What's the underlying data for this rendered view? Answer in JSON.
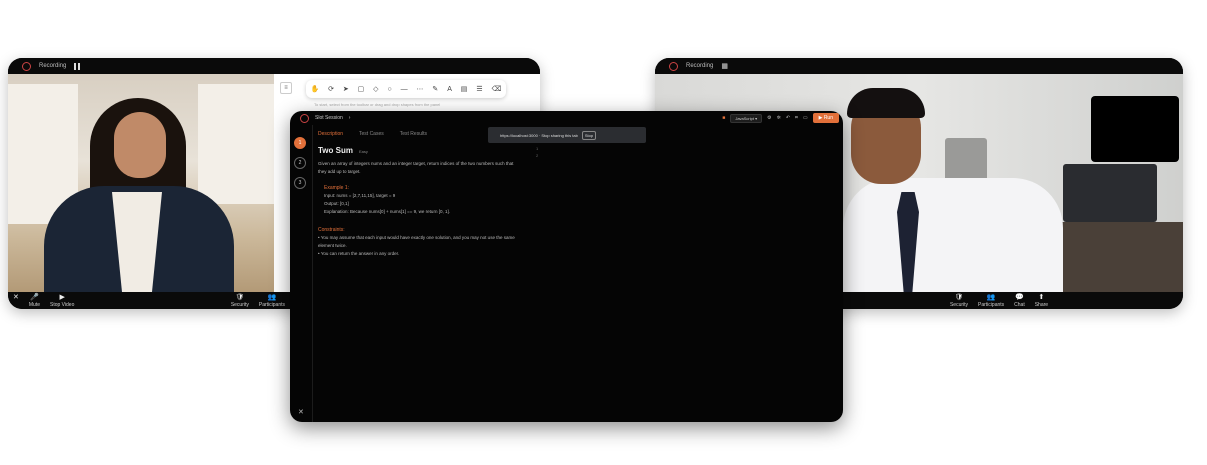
{
  "left_window": {
    "topbar_label": "Recording",
    "whiteboard_hint": "To start, select from the toolbar or drag and drop shapes from the panel",
    "whiteboard_tools": [
      "✋",
      "⟳",
      "➤",
      "▢",
      "◇",
      "○",
      "—",
      "⋯",
      "✎",
      "A",
      "▤",
      "☰",
      "⌫"
    ],
    "bottom_left": [
      {
        "icon": "✕",
        "label": ""
      },
      {
        "icon": "🎤",
        "label": "Mute"
      },
      {
        "icon": "▶",
        "label": "Stop Video"
      }
    ],
    "bottom_right": [
      {
        "icon": "🛡",
        "label": "Security"
      },
      {
        "icon": "👥",
        "label": "Participants"
      }
    ]
  },
  "right_window": {
    "topbar_label": "Recording",
    "bottom_tools": [
      {
        "icon": "🛡",
        "label": "Security"
      },
      {
        "icon": "👥",
        "label": "Participants"
      },
      {
        "icon": "💬",
        "label": "Chat"
      },
      {
        "icon": "⬆",
        "label": "Share"
      }
    ]
  },
  "center_window": {
    "title": "Slot Session",
    "tabs": [
      "Description",
      "Test Cases",
      "Test Results"
    ],
    "active_tab": "Description",
    "steps": [
      "1",
      "2",
      "3"
    ],
    "url_popup": {
      "text": "https://localhost:3000 · Stop sharing this tab",
      "button": "Stop"
    },
    "language": "JavaScript",
    "run_label": "▶ Run",
    "problem": {
      "title": "Two Sum",
      "difficulty": "Easy",
      "description": "Given an array of integers nums and an integer target, return indices of the two numbers such that they add up to target.",
      "example_title": "Example 1:",
      "input": "Input: nums = [2,7,11,15], target = 9",
      "output": "Output: [0,1]",
      "explanation": "Explanation: Because nums[0] + nums[1] == 9, we return [0, 1].",
      "constraints_title": "Constraints:",
      "constraints": [
        "You may assume that each input would have exactly one solution, and you may not use the same element twice.",
        "You can return the answer in any order."
      ]
    },
    "editor_line_numbers": [
      "1",
      "2"
    ],
    "corner_icon": "✕"
  }
}
